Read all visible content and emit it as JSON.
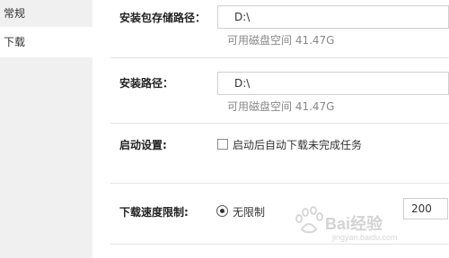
{
  "sidebar": {
    "items": [
      {
        "label": "常规"
      },
      {
        "label": "下载"
      }
    ]
  },
  "settings": {
    "package_path_label": "安装包存储路径：",
    "package_path_value": "D:\\",
    "package_path_hint": "可用磁盘空间 41.47G",
    "install_path_label": "安装路径：",
    "install_path_value": "D:\\",
    "install_path_hint": "可用磁盘空间 41.47G",
    "startup_label": "启动设置:",
    "startup_checkbox_label": "启动后自动下载未完成任务",
    "startup_checked": false,
    "speed_limit_label": "下载速度限制:",
    "speed_unlimited_label": "无限制",
    "speed_limit_value": "200"
  },
  "watermark": {
    "text": "Bai经验",
    "subtext": "jingyan.baidu.com"
  }
}
